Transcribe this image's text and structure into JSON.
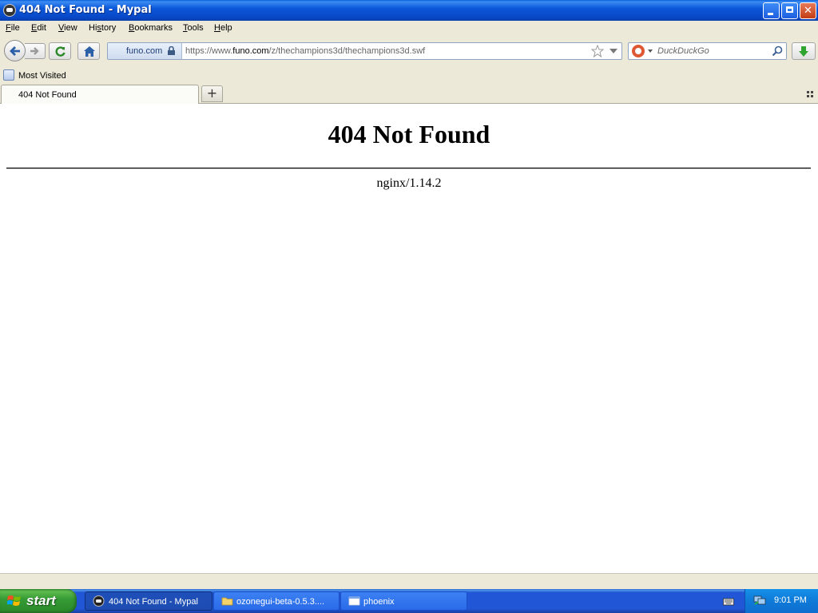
{
  "window": {
    "title": "404 Not Found - Mypal"
  },
  "menu": [
    {
      "prefix": "",
      "underline": "F",
      "rest": "ile"
    },
    {
      "prefix": "",
      "underline": "E",
      "rest": "dit"
    },
    {
      "prefix": "",
      "underline": "V",
      "rest": "iew"
    },
    {
      "prefix": "Hi",
      "underline": "s",
      "rest": "tory"
    },
    {
      "prefix": "",
      "underline": "B",
      "rest": "ookmarks"
    },
    {
      "prefix": "",
      "underline": "T",
      "rest": "ools"
    },
    {
      "prefix": "",
      "underline": "H",
      "rest": "elp"
    }
  ],
  "urlbar": {
    "identity": "funo.com",
    "url_prefix": "https://www.",
    "url_domain": "funo.com",
    "url_path": "/z/thechampions3d/thechampions3d.swf"
  },
  "search": {
    "placeholder": "DuckDuckGo"
  },
  "bookmarks": {
    "most_visited": "Most Visited"
  },
  "tabs": [
    {
      "label": "404 Not Found"
    }
  ],
  "newtab": {
    "label": "+"
  },
  "page": {
    "heading": "404 Not Found",
    "server": "nginx/1.14.2"
  },
  "taskbar": {
    "start": "start",
    "items": [
      {
        "label": "404 Not Found - Mypal",
        "active": true
      },
      {
        "label": "ozonegui-beta-0.5.3....",
        "active": false
      },
      {
        "label": "phoenix",
        "active": false
      }
    ],
    "clock": "9:01 PM"
  },
  "colors": {
    "titlebar": "#0b58d9",
    "taskbar": "#2157d7",
    "start": "#379c35",
    "tray": "#0f7ad8"
  }
}
